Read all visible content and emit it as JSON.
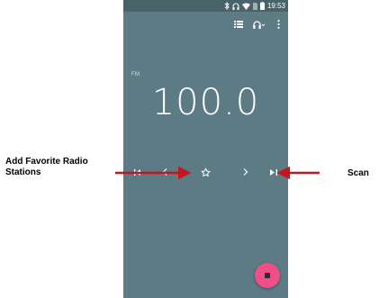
{
  "status_bar": {
    "icons": [
      "bluetooth-icon",
      "headset-icon",
      "wifi-icon",
      "sim-icon",
      "battery-icon"
    ],
    "time": "19:53"
  },
  "toolbar": {
    "icons": [
      "list-icon",
      "headset-output-icon",
      "more-vert-icon"
    ]
  },
  "radio": {
    "band": "FM",
    "frequency": "100.0",
    "background_color": "#5d7b84"
  },
  "controls": {
    "icons": [
      "skip-previous-icon",
      "chevron-left-icon",
      "star-outline-icon",
      "chevron-right-icon",
      "skip-next-icon"
    ]
  },
  "fab": {
    "icon": "stop-icon",
    "color": "#ef4f86"
  },
  "annotations": {
    "favorite_label": "Add Favorite Radio Stations",
    "scan_label": "Scan",
    "arrow_color": "#c8141e"
  }
}
